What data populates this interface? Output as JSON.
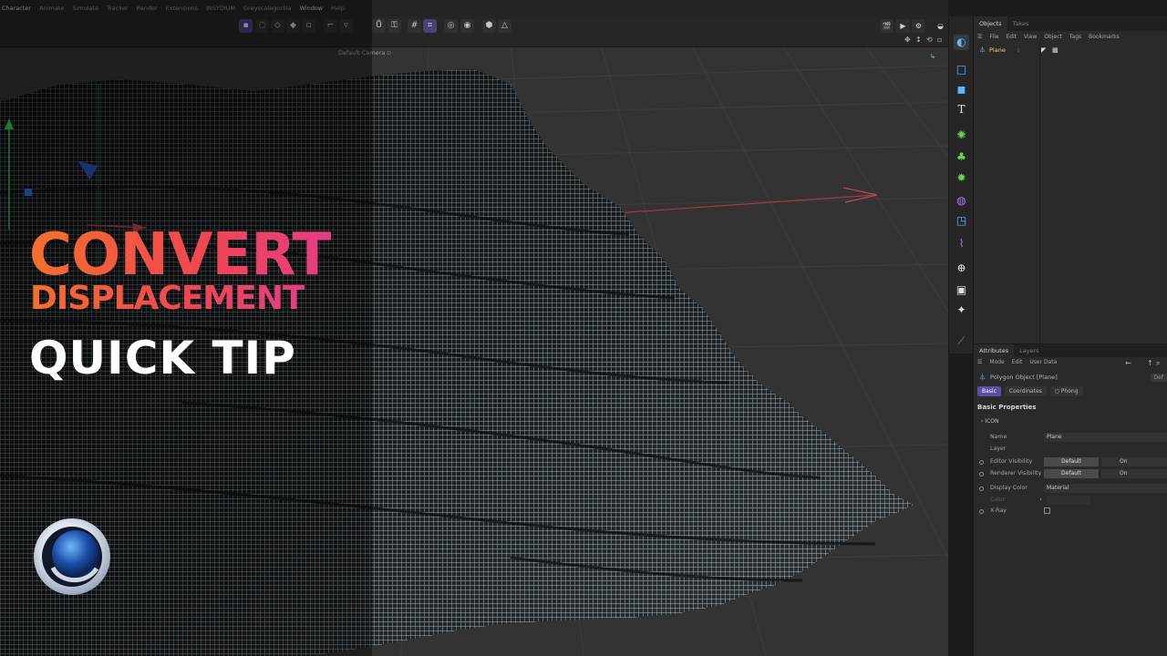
{
  "menubar": {
    "items": [
      "Character",
      "Animate",
      "Simulate",
      "Tracker",
      "Render",
      "Extensions",
      "INSYDIUM",
      "Greyscalegorilla",
      "Window",
      "Help"
    ]
  },
  "viewport": {
    "camera_label": "Default Camera ▫"
  },
  "overlay": {
    "title_line1": "CONVERT",
    "title_line2": "DISPLACEMENT",
    "title_line3": "QUICK TIP"
  },
  "objects_panel": {
    "tabs": [
      "Objects",
      "Takes"
    ],
    "menu": [
      "File",
      "Edit",
      "View",
      "Object",
      "Tags",
      "Bookmarks"
    ],
    "object_name": "Plane"
  },
  "attributes_panel": {
    "tabs": [
      "Attributes",
      "Layers"
    ],
    "menu": [
      "Mode",
      "Edit",
      "User Data"
    ],
    "object_type": "Polygon Object [Plane]",
    "default_btn": "Def",
    "sub_tabs": [
      "Basic",
      "Coordinates",
      "◻ Phong"
    ],
    "section_title": "Basic Properties",
    "icon_label": "› ICON",
    "props": {
      "name_label": "Name",
      "name_value": "Plane",
      "layer_label": "Layer",
      "editor_vis_label": "Editor Visibility",
      "editor_vis_default": "Default",
      "editor_vis_on": "On",
      "render_vis_label": "Renderer Visibility",
      "render_vis_default": "Default",
      "render_vis_on": "On",
      "display_color_label": "Display Color",
      "display_color_value": "Material",
      "color_label": "Color",
      "xray_label": "X-Ray"
    }
  },
  "colors": {
    "accent_purple": "#5a4fa6",
    "title_gradient_start": "#f4702c",
    "title_gradient_end": "#e53d86",
    "object_name": "#f2d05a"
  },
  "icons": [
    "cinema4d-logo-icon",
    "camera-icon",
    "cube-icon",
    "text-icon",
    "spline-icon",
    "generator-icon",
    "deformer-icon",
    "field-icon",
    "environment-icon",
    "light-icon"
  ]
}
